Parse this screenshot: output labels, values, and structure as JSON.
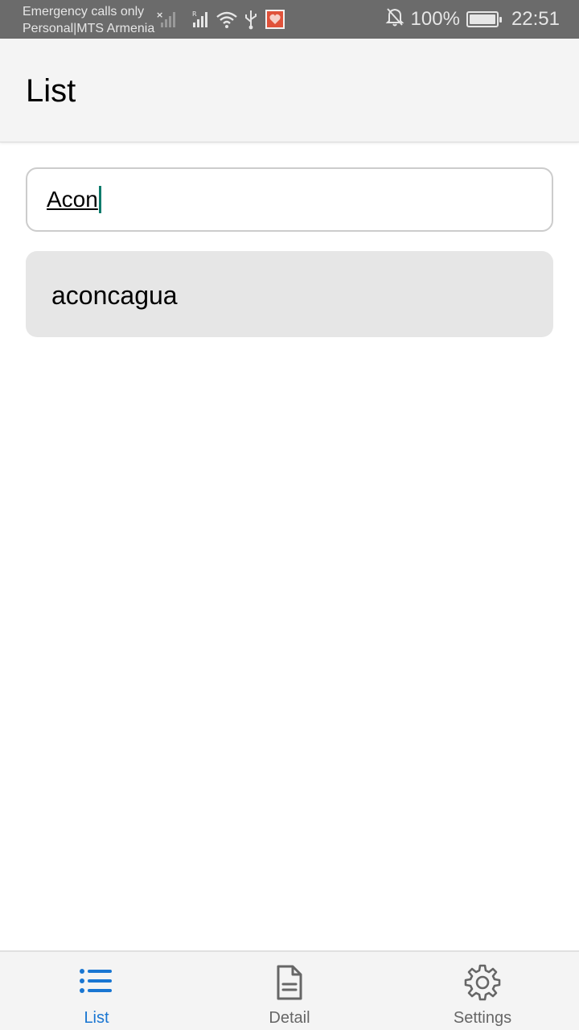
{
  "status_bar": {
    "carrier_line1": "Emergency calls only",
    "carrier_line2": "Personal|MTS Armenia",
    "battery_text": "100%",
    "time": "22:51"
  },
  "app_bar": {
    "title": "List"
  },
  "search": {
    "value": "Acon"
  },
  "results": [
    {
      "label": "aconcagua"
    }
  ],
  "bottom_nav": {
    "items": [
      {
        "label": "List",
        "icon": "list-icon",
        "active": true
      },
      {
        "label": "Detail",
        "icon": "document-icon",
        "active": false
      },
      {
        "label": "Settings",
        "icon": "gear-icon",
        "active": false
      }
    ]
  },
  "colors": {
    "accent": "#1976d2",
    "caret": "#0f7b6c",
    "status_bar": "#6b6b6b"
  }
}
